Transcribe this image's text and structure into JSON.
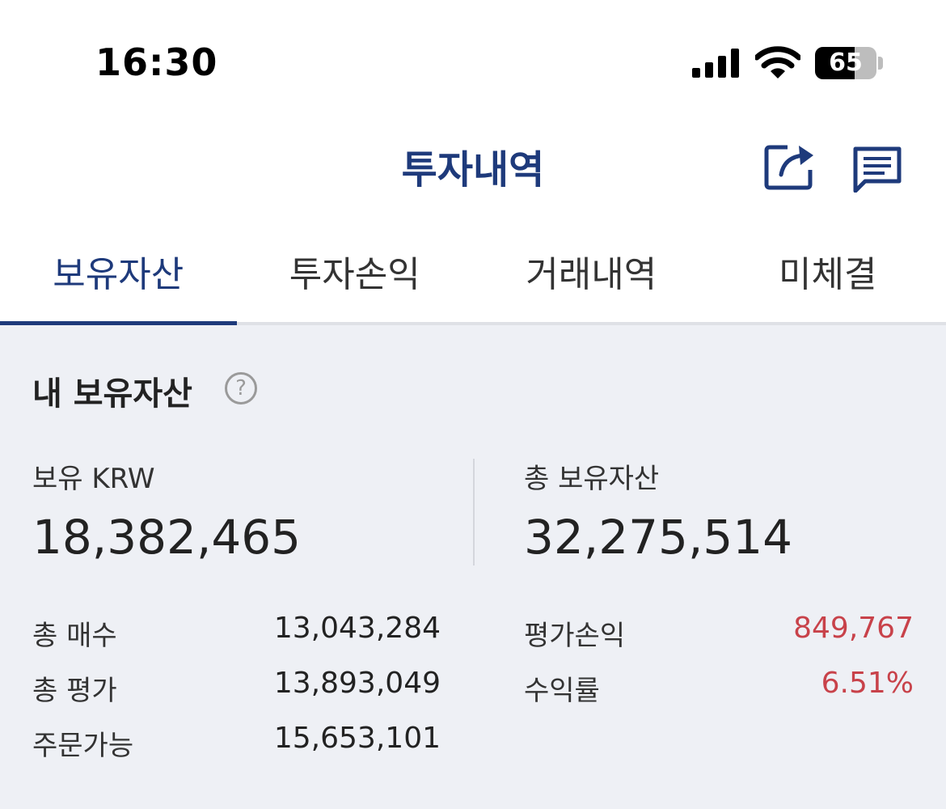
{
  "status_bar": {
    "time": "16:30",
    "battery": "65"
  },
  "header": {
    "title": "투자내역"
  },
  "tabs": [
    {
      "label": "보유자산",
      "active": true
    },
    {
      "label": "투자손익",
      "active": false
    },
    {
      "label": "거래내역",
      "active": false
    },
    {
      "label": "미체결",
      "active": false
    }
  ],
  "section": {
    "title": "내 보유자산",
    "help": "?"
  },
  "summary": {
    "krw_label": "보유 KRW",
    "krw_value": "18,382,465",
    "total_label": "총 보유자산",
    "total_value": "32,275,514"
  },
  "details_left": [
    {
      "label": "총 매수",
      "value": "13,043,284"
    },
    {
      "label": "총 평가",
      "value": "13,893,049"
    },
    {
      "label": "주문가능",
      "value": "15,653,101"
    }
  ],
  "details_right": [
    {
      "label": "평가손익",
      "value": "849,767"
    },
    {
      "label": "수익률",
      "value": "6.51%"
    }
  ],
  "colors": {
    "accent": "#1e3a7b",
    "profit": "#c8424a",
    "background": "#eef0f5"
  }
}
